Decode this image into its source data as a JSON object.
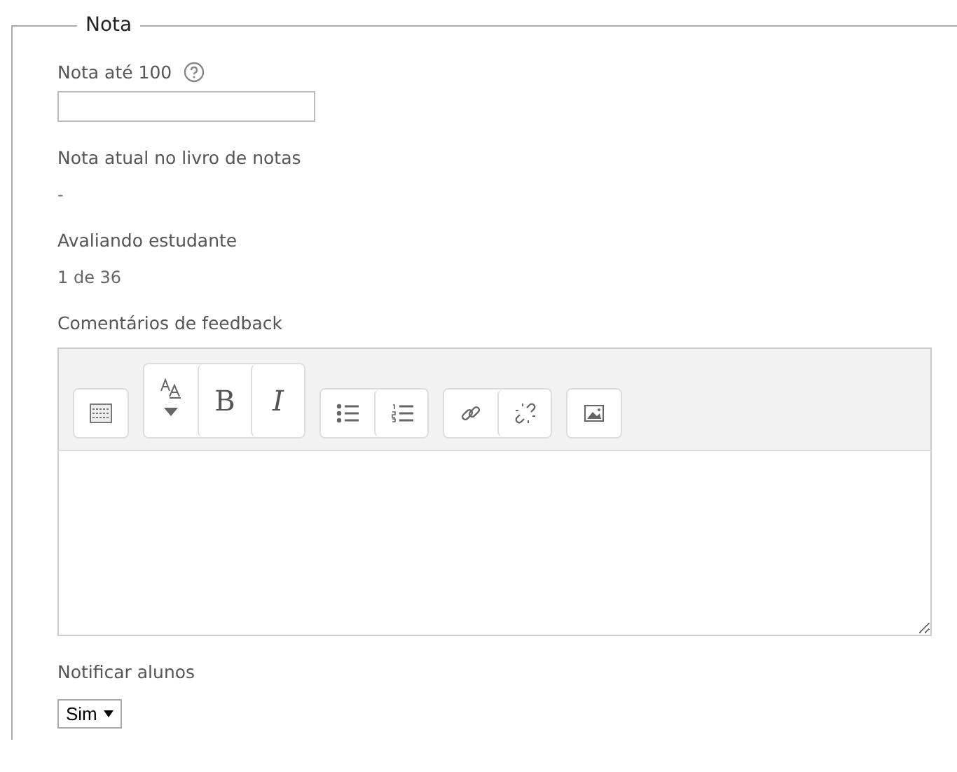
{
  "section": {
    "legend": "Nota"
  },
  "grade": {
    "label": "Nota até 100"
  },
  "current_grade": {
    "label": "Nota atual no livro de notas",
    "value": "-"
  },
  "student": {
    "label": "Avaliando estudante",
    "value": "1 de 36"
  },
  "feedback": {
    "label": "Comentários de feedback",
    "toolbar": [
      [
        {
          "kind": "keyboard"
        }
      ],
      [
        {
          "kind": "fontsize"
        },
        {
          "kind": "bold",
          "label": "B"
        },
        {
          "kind": "italic",
          "label": "I"
        }
      ],
      [
        {
          "kind": "bullets"
        },
        {
          "kind": "numbers"
        }
      ],
      [
        {
          "kind": "link"
        },
        {
          "kind": "unlink"
        }
      ],
      [
        {
          "kind": "image"
        }
      ]
    ]
  },
  "notify": {
    "label": "Notificar alunos",
    "value": "Sim"
  }
}
